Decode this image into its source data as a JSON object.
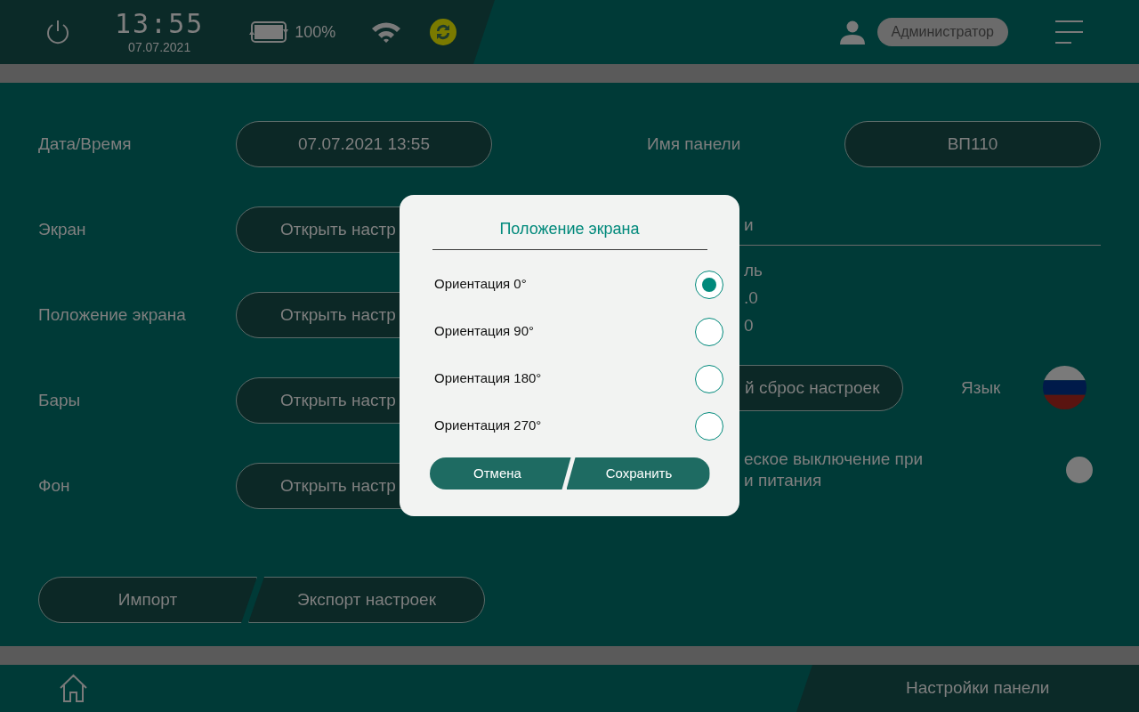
{
  "status_bar": {
    "time": "13:55",
    "date": "07.07.2021",
    "battery": "100%",
    "user": "Администратор"
  },
  "settings": [
    {
      "label": "Дата/Время",
      "button": "07.07.2021 13:55",
      "kind": "value"
    },
    {
      "label": "Экран",
      "button": "Открыть настр",
      "kind": "open"
    },
    {
      "label": "Положение экрана",
      "button": "Открыть настр",
      "kind": "open"
    },
    {
      "label": "Бары",
      "button": "Открыть настр",
      "kind": "open"
    },
    {
      "label": "Фон",
      "button": "Открыть настр",
      "kind": "open"
    }
  ],
  "panel_name": {
    "label": "Имя панели",
    "value": "ВП110"
  },
  "field_label": "и",
  "info_lines": [
    "ль",
    ".0",
    "0"
  ],
  "reset_button": "й сброс настроек",
  "language": {
    "label": "Язык"
  },
  "auto_off": {
    "lines": [
      "еское выключение при",
      "и питания"
    ],
    "on": false
  },
  "bottom_buttons": [
    "Импорт",
    "Экспорт настроек"
  ],
  "footer": {
    "title": "Настройки панели"
  },
  "dialog": {
    "title": "Положение экрана",
    "options": [
      {
        "label": "Ориентация 0°",
        "selected": true
      },
      {
        "label": "Ориентация 90°",
        "selected": false
      },
      {
        "label": "Ориентация 180°",
        "selected": false
      },
      {
        "label": "Ориентация 270°",
        "selected": false
      }
    ],
    "buttons": [
      "Отмена",
      "Сохранить"
    ]
  }
}
